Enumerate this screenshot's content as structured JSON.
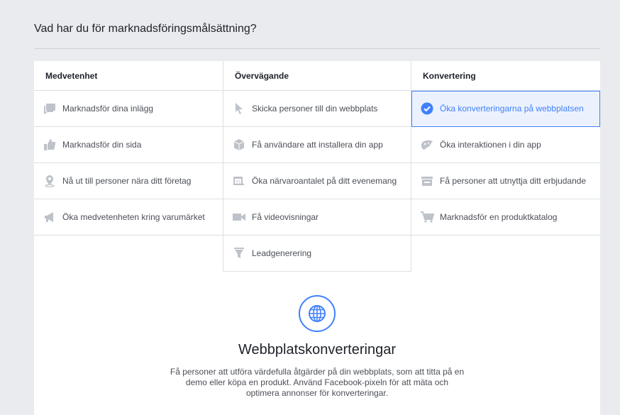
{
  "heading": "Vad har du för marknadsföringsmålsättning?",
  "columns": [
    {
      "title": "Medvetenhet",
      "items": [
        {
          "label": "Marknadsför dina inlägg",
          "icon": "post-icon"
        },
        {
          "label": "Marknadsför din sida",
          "icon": "thumbs-up-icon"
        },
        {
          "label": "Nå ut till personer nära ditt företag",
          "icon": "location-pin-icon"
        },
        {
          "label": "Öka medvetenheten kring varumärket",
          "icon": "megaphone-icon"
        }
      ]
    },
    {
      "title": "Övervägande",
      "items": [
        {
          "label": "Skicka personer till din webbplats",
          "icon": "cursor-icon"
        },
        {
          "label": "Få användare att installera din app",
          "icon": "box-icon"
        },
        {
          "label": "Öka närvaroantalet på ditt evenemang",
          "icon": "calendar-icon"
        },
        {
          "label": "Få videovisningar",
          "icon": "video-camera-icon"
        },
        {
          "label": "Leadgenerering",
          "icon": "funnel-icon"
        }
      ]
    },
    {
      "title": "Konvertering",
      "items": [
        {
          "label": "Öka konverteringarna på webbplatsen",
          "icon": "check-circle-icon",
          "selected": true
        },
        {
          "label": "Öka interaktionen i din app",
          "icon": "gamepad-icon"
        },
        {
          "label": "Få personer att utnyttja ditt erbjudande",
          "icon": "offer-icon"
        },
        {
          "label": "Marknadsför en produktkatalog",
          "icon": "shopping-cart-icon"
        }
      ]
    }
  ],
  "detail": {
    "title": "Webbplatskonverteringar",
    "description": "Få personer att utföra värdefulla åtgärder på din webbplats, som att titta på en demo eller köpa en produkt. Använd Facebook-pixeln för att mäta och optimera annonser för konverteringar.",
    "icon": "globe-icon"
  },
  "colors": {
    "accent": "#4080ff",
    "icon_gray": "#bec2c9",
    "selected_bg": "#ecf2fd"
  }
}
